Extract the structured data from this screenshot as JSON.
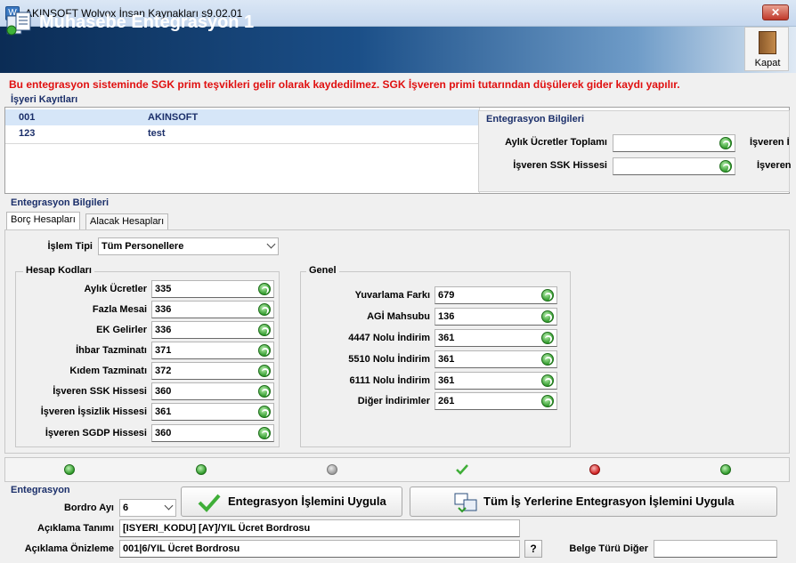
{
  "window": {
    "title": "AKINSOFT Wolvox İnsan Kaynakları s9.02.01",
    "close_label": "✕"
  },
  "header": {
    "title": "Muhasebe Entegrasyon 1",
    "close_label": "Kapat"
  },
  "warning": "Bu entegrasyon sisteminde SGK prim teşvikleri gelir olarak kaydedilmez. SGK İşveren primi tutarından düşülerek gider kaydı yapılır.",
  "records": {
    "title": "İşyeri Kayıtları",
    "rows": [
      {
        "code": "001",
        "name": "AKINSOFT"
      },
      {
        "code": "123",
        "name": "test"
      }
    ]
  },
  "integration_info_panel": {
    "title": "Entegrasyon Bilgileri",
    "fields": [
      {
        "label": "Aylık Ücretler Toplamı",
        "value": ""
      },
      {
        "label": "İşveren SSK Hissesi",
        "value": ""
      }
    ],
    "partial_labels": [
      "İşveren İ",
      "İşveren"
    ]
  },
  "integration": {
    "title": "Entegrasyon Bilgileri",
    "tabs": [
      "Borç Hesapları",
      "Alacak Hesapları"
    ],
    "process_type_label": "İşlem Tipi",
    "process_type_value": "Tüm Personellere",
    "account_codes": {
      "title": "Hesap Kodları",
      "items": [
        {
          "label": "Aylık Ücretler",
          "value": "335"
        },
        {
          "label": "Fazla Mesai",
          "value": "336"
        },
        {
          "label": "EK Gelirler",
          "value": "336"
        },
        {
          "label": "İhbar Tazminatı",
          "value": "371"
        },
        {
          "label": "Kıdem Tazminatı",
          "value": "372"
        },
        {
          "label": "İşveren SSK Hissesi",
          "value": "360"
        },
        {
          "label": "İşveren İşsizlik Hissesi",
          "value": "361"
        },
        {
          "label": "İşveren SGDP Hissesi",
          "value": "360"
        }
      ]
    },
    "general": {
      "title": "Genel",
      "items": [
        {
          "label": "Yuvarlama Farkı",
          "value": "679"
        },
        {
          "label": "AGİ Mahsubu",
          "value": "136"
        },
        {
          "label": "4447 Nolu İndirim",
          "value": "361"
        },
        {
          "label": "5510 Nolu İndirim",
          "value": "361"
        },
        {
          "label": "6111 Nolu İndirim",
          "value": "361"
        },
        {
          "label": "Diğer İndirimler",
          "value": "261"
        }
      ]
    }
  },
  "bottom": {
    "title": "Entegrasyon",
    "payroll_month_label": "Bordro Ayı",
    "payroll_month_value": "6",
    "apply_button": "Entegrasyon İşlemini Uygula",
    "apply_all_button": "Tüm İş Yerlerine Entegrasyon İşlemini Uygula",
    "description_label": "Açıklama Tanımı",
    "description_value": "[ISYERI_KODU] [AY]/YIL Ücret Bordrosu",
    "preview_label": "Açıklama Önizleme",
    "preview_value": "001|6/YIL Ücret Bordrosu",
    "help_label": "?",
    "doc_type_label": "Belge Türü Diğer",
    "doc_type_value": ""
  }
}
